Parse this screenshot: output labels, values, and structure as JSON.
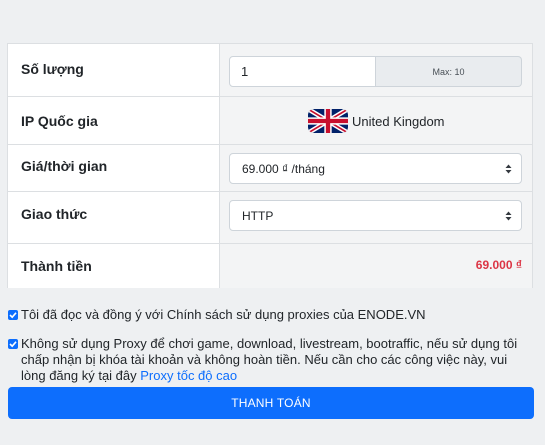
{
  "order": {
    "quantity_label": "Số lượng",
    "quantity_value": "1",
    "quantity_max": "Max: 10",
    "country_label": "IP Quốc gia",
    "country_flag_icon": "uk-flag-icon",
    "country_name": "United Kingdom",
    "price_period_label": "Giá/thời gian",
    "price_period_selected": "69.000 ₫ /tháng",
    "protocol_label": "Giao thức",
    "protocol_selected": "HTTP",
    "total_label": "Thành tiền",
    "total_value": "69.000 ₫"
  },
  "agreements": {
    "terms_text": "Tôi đã đọc và đồng ý với Chính sách sử dụng proxies của ENODE.VN",
    "terms_checked": true,
    "usage_text": "Không sử dụng Proxy để chơi game, download, livestream, bootraffic, nếu sử dụng tôi chấp nhận bị khóa tài khoản và không hoàn tiền. Nếu cần cho các công việc này, vui lòng đăng ký tại đây",
    "usage_link": "Proxy tốc độ cao",
    "usage_checked": true
  },
  "actions": {
    "pay_label": "THANH TOÁN"
  },
  "colors": {
    "accent": "#0d6efd",
    "price": "#dc3545"
  }
}
